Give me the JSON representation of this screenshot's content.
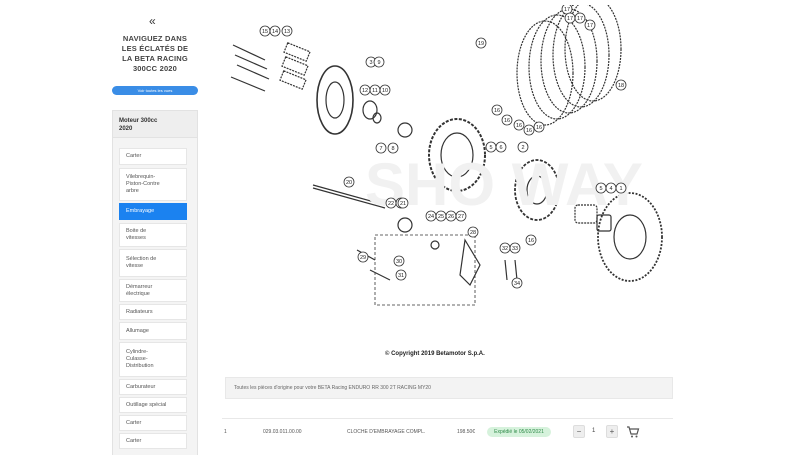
{
  "sidebar": {
    "collapse_glyph": "«",
    "title_line1": "NAVIGUEZ DANS",
    "title_line2": "LES ÉCLATÉS DE",
    "title_line3": "LA BETA RACING",
    "title_line4": "300CC 2020",
    "view_all_label": "Voir toutes les vues",
    "section_line1": "Moteur 300cc",
    "section_line2": "2020",
    "items": [
      {
        "line1": "Carter",
        "line2": "",
        "line3": ""
      },
      {
        "line1": "Vilebrequin-",
        "line2": "Piston-Contre",
        "line3": "arbre"
      },
      {
        "line1": "Embrayage",
        "line2": "",
        "line3": ""
      },
      {
        "line1": "Boite de",
        "line2": "vitesses",
        "line3": ""
      },
      {
        "line1": "Sélection de",
        "line2": "vitesse",
        "line3": ""
      },
      {
        "line1": "Démarreur",
        "line2": "électrique",
        "line3": ""
      },
      {
        "line1": "Radiateurs",
        "line2": "",
        "line3": ""
      },
      {
        "line1": "Allumage",
        "line2": "",
        "line3": ""
      },
      {
        "line1": "Cylindre-",
        "line2": "Culasse-",
        "line3": "Distribution"
      },
      {
        "line1": "Carburateur",
        "line2": "",
        "line3": ""
      },
      {
        "line1": "Outillage spécial",
        "line2": "",
        "line3": ""
      },
      {
        "line1": "Carter",
        "line2": "",
        "line3": ""
      },
      {
        "line1": "Carter",
        "line2": "",
        "line3": ""
      }
    ]
  },
  "diagram": {
    "copyright": "© Copyright 2019 Betamotor S.p.A.",
    "callouts": [
      "15",
      "14",
      "13",
      "3",
      "9",
      "12",
      "11",
      "10",
      "8",
      "7",
      "17",
      "17",
      "17",
      "17",
      "19",
      "18",
      "16",
      "16",
      "16",
      "16",
      "16",
      "20",
      "5",
      "6",
      "2",
      "23",
      "22",
      "21",
      "24",
      "25",
      "26",
      "27",
      "28",
      "29",
      "30",
      "31",
      "32",
      "33",
      "34",
      "5",
      "4",
      "1",
      "16"
    ]
  },
  "info_bar": {
    "text": "Toutes les pièces d'origine pour votre BETA Racing ENDURO RR 300 2T RACING MY20"
  },
  "part": {
    "index": "1",
    "reference": "029.03.011.00.00",
    "name": "CLOCHE D'EMBRAYAGE COMPL.",
    "price": "198.50€",
    "status": "Expédié le 05/02/2021",
    "minus": "−",
    "qty": "1",
    "plus": "+"
  },
  "colors": {
    "accent": "#1b82f0",
    "button": "#3a8de6",
    "status_bg": "#d6f2dc",
    "status_text": "#2e8a48"
  }
}
